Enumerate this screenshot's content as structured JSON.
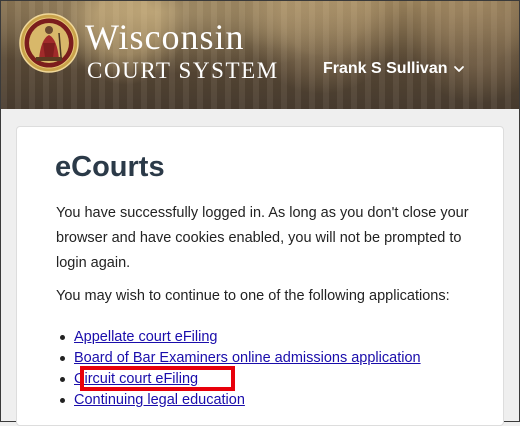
{
  "header": {
    "logo_title": "Wisconsin",
    "logo_subtitle": "COURT SYSTEM",
    "user_name": "Frank S Sullivan",
    "seal_icon": "state-seal-icon",
    "menu_icon": "chevron-down-icon"
  },
  "main": {
    "title": "eCourts",
    "paragraph_1": "You have successfully logged in. As long as you don't close your browser and have cookies enabled, you will not be prompted to login again.",
    "paragraph_2": "You may wish to continue to one of the following applications:",
    "apps": [
      {
        "label": "Appellate court eFiling"
      },
      {
        "label": "Board of Bar Examiners online admissions application"
      },
      {
        "label": "Circuit court eFiling"
      },
      {
        "label": "Continuing legal education"
      }
    ]
  },
  "colors": {
    "title": "#2b3a48",
    "link": "#1a0dab",
    "highlight": "#e8000b"
  }
}
